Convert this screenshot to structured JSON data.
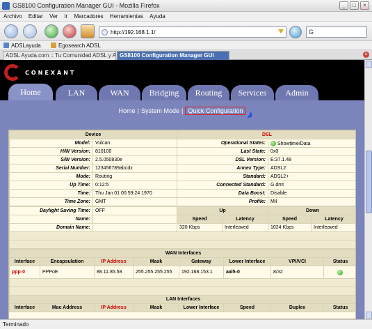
{
  "window": {
    "title": "GS8100 Configuration Manager GUI - Mozilla Firefox",
    "minimize": "_",
    "maximize": "□",
    "close": "×"
  },
  "menu": [
    "Archivo",
    "Editar",
    "Ver",
    "Ir",
    "Marcadores",
    "Herramientas",
    "Ayuda"
  ],
  "nav": {
    "url": "http://192.168.1.1/",
    "search_placeholder": "G"
  },
  "bookmarks": [
    "ADSLayuda",
    "Egosearch ADSL"
  ],
  "browser_tabs": [
    {
      "label": "ADSL Ayuda.com :: Tu Comunidad ADSL y A...",
      "active": false
    },
    {
      "label": "GS8100 Configuration Manager GUI",
      "active": true
    }
  ],
  "router": {
    "brand": "CONEXANT",
    "tabs": [
      "Home",
      "LAN",
      "WAN",
      "Bridging",
      "Routing",
      "Services",
      "Admin"
    ],
    "subnav": [
      "Home",
      "System Mode",
      "Quick Configuration"
    ],
    "device_header": "Device",
    "dsl_header": "DSL",
    "device": [
      {
        "label": "Model:",
        "value": "Vulcan"
      },
      {
        "label": "H/W Version:",
        "value": "810100"
      },
      {
        "label": "S/W Version:",
        "value": "2.5.050830e"
      },
      {
        "label": "Serial Number:",
        "value": "123456789abcdx"
      },
      {
        "label": "Mode:",
        "value": "Routing"
      },
      {
        "label": "Up Time:",
        "value": "0:12:5"
      },
      {
        "label": "Time:",
        "value": "Thu Jan 01 00:59:24 1970"
      },
      {
        "label": "Time Zone:",
        "value": "GMT"
      },
      {
        "label": "Daylight Saving Time:",
        "value": "OFF"
      },
      {
        "label": "Name:",
        "value": ""
      },
      {
        "label": "Domain Name:",
        "value": ""
      }
    ],
    "dsl": [
      {
        "label": "Operational States:",
        "value": "Showtime/Data"
      },
      {
        "label": "Last State:",
        "value": "0x0"
      },
      {
        "label": "DSL Version:",
        "value": "E:37.1.48"
      },
      {
        "label": "Annex Type:",
        "value": "ADSL2"
      },
      {
        "label": "Standard:",
        "value": "ADSL2+"
      },
      {
        "label": "Connected Standard:",
        "value": "G.dmt"
      },
      {
        "label": "Data Boost:",
        "value": "Disable"
      },
      {
        "label": "Profile:",
        "value": "MII"
      }
    ],
    "rates": {
      "up_header": "Up",
      "down_header": "Down",
      "speed_header": "Speed",
      "latency_header": "Latency",
      "up_speed": "320 Kbps",
      "up_latency": "Interleaved",
      "down_speed": "1024 Kbps",
      "down_latency": "Interleaved"
    },
    "wan_title": "WAN Interfaces",
    "wan_columns": [
      "Interface",
      "Encapsulation",
      "IP Address",
      "Mask",
      "Gateway",
      "Lower Interface",
      "VPI/VCI",
      "Status"
    ],
    "wan_rows": [
      [
        "ppp-0",
        "PPPoE",
        "88.11.85.58",
        "255.255.255.255",
        "192.168.153.1",
        "aal5-0",
        "8/32",
        ""
      ]
    ],
    "lan_title": "LAN Interfaces",
    "lan_columns": [
      "Interface",
      "Mac Address",
      "IP Address",
      "Mask",
      "Lower Interface",
      "Speed",
      "Duplex",
      "Status"
    ]
  },
  "status": "Terminado"
}
